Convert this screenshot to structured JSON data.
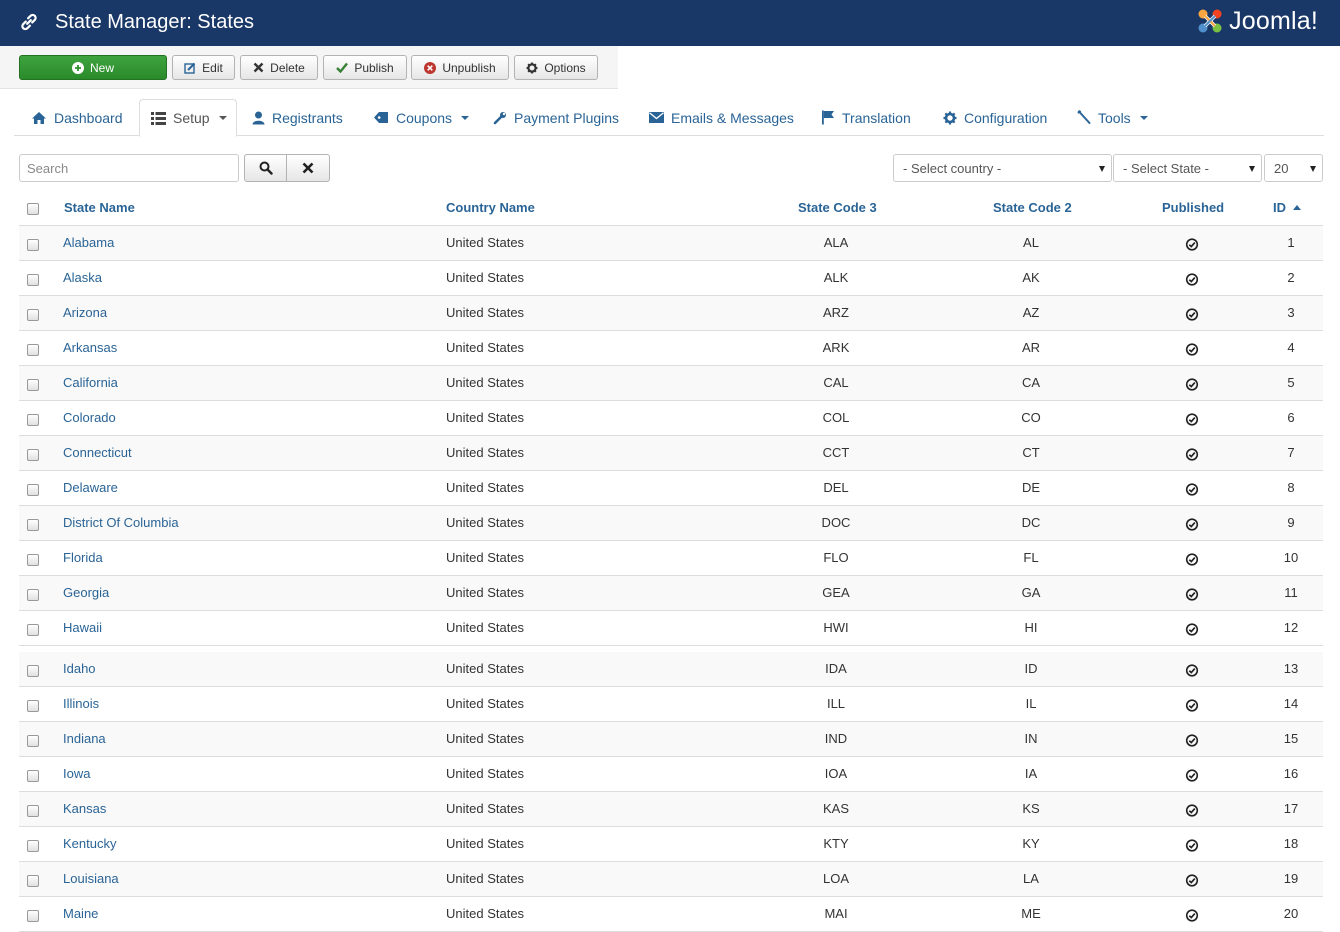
{
  "header": {
    "title": "State Manager: States",
    "logo_text": "Joomla!",
    "bg_color": "#1a3867"
  },
  "toolbar": {
    "new_label": "New",
    "edit_label": "Edit",
    "delete_label": "Delete",
    "publish_label": "Publish",
    "unpublish_label": "Unpublish",
    "options_label": "Options"
  },
  "tabs": [
    {
      "label": "Dashboard",
      "icon": "home-icon"
    },
    {
      "label": "Setup",
      "icon": "list-icon",
      "active": true
    },
    {
      "label": "Registrants",
      "icon": "user-icon"
    },
    {
      "label": "Coupons",
      "icon": "tag-icon"
    },
    {
      "label": "Payment Plugins",
      "icon": "wrench-icon"
    },
    {
      "label": "Emails & Messages",
      "icon": "envelope-icon"
    },
    {
      "label": "Translation",
      "icon": "flag-icon"
    },
    {
      "label": "Configuration",
      "icon": "gear-icon"
    },
    {
      "label": "Tools",
      "icon": "tools-icon"
    }
  ],
  "filters": {
    "search_placeholder": "Search",
    "country_select": "- Select country -",
    "state_select": "- Select State -",
    "limit_select": "20"
  },
  "table": {
    "columns": {
      "state_name": "State Name",
      "country_name": "Country Name",
      "code3": "State Code 3",
      "code2": "State Code 2",
      "published": "Published",
      "id": "ID"
    },
    "rows": [
      {
        "name": "Alabama",
        "country": "United States",
        "code3": "ALA",
        "code2": "AL",
        "id": "1"
      },
      {
        "name": "Alaska",
        "country": "United States",
        "code3": "ALK",
        "code2": "AK",
        "id": "2"
      },
      {
        "name": "Arizona",
        "country": "United States",
        "code3": "ARZ",
        "code2": "AZ",
        "id": "3"
      },
      {
        "name": "Arkansas",
        "country": "United States",
        "code3": "ARK",
        "code2": "AR",
        "id": "4"
      },
      {
        "name": "California",
        "country": "United States",
        "code3": "CAL",
        "code2": "CA",
        "id": "5"
      },
      {
        "name": "Colorado",
        "country": "United States",
        "code3": "COL",
        "code2": "CO",
        "id": "6"
      },
      {
        "name": "Connecticut",
        "country": "United States",
        "code3": "CCT",
        "code2": "CT",
        "id": "7"
      },
      {
        "name": "Delaware",
        "country": "United States",
        "code3": "DEL",
        "code2": "DE",
        "id": "8"
      },
      {
        "name": "District Of Columbia",
        "country": "United States",
        "code3": "DOC",
        "code2": "DC",
        "id": "9"
      },
      {
        "name": "Florida",
        "country": "United States",
        "code3": "FLO",
        "code2": "FL",
        "id": "10"
      },
      {
        "name": "Georgia",
        "country": "United States",
        "code3": "GEA",
        "code2": "GA",
        "id": "11"
      },
      {
        "name": "Hawaii",
        "country": "United States",
        "code3": "HWI",
        "code2": "HI",
        "id": "12"
      },
      {
        "name": "Idaho",
        "country": "United States",
        "code3": "IDA",
        "code2": "ID",
        "id": "13"
      },
      {
        "name": "Illinois",
        "country": "United States",
        "code3": "ILL",
        "code2": "IL",
        "id": "14"
      },
      {
        "name": "Indiana",
        "country": "United States",
        "code3": "IND",
        "code2": "IN",
        "id": "15"
      },
      {
        "name": "Iowa",
        "country": "United States",
        "code3": "IOA",
        "code2": "IA",
        "id": "16"
      },
      {
        "name": "Kansas",
        "country": "United States",
        "code3": "KAS",
        "code2": "KS",
        "id": "17"
      },
      {
        "name": "Kentucky",
        "country": "United States",
        "code3": "KTY",
        "code2": "KY",
        "id": "18"
      },
      {
        "name": "Louisiana",
        "country": "United States",
        "code3": "LOA",
        "code2": "LA",
        "id": "19"
      },
      {
        "name": "Maine",
        "country": "United States",
        "code3": "MAI",
        "code2": "ME",
        "id": "20"
      }
    ]
  }
}
